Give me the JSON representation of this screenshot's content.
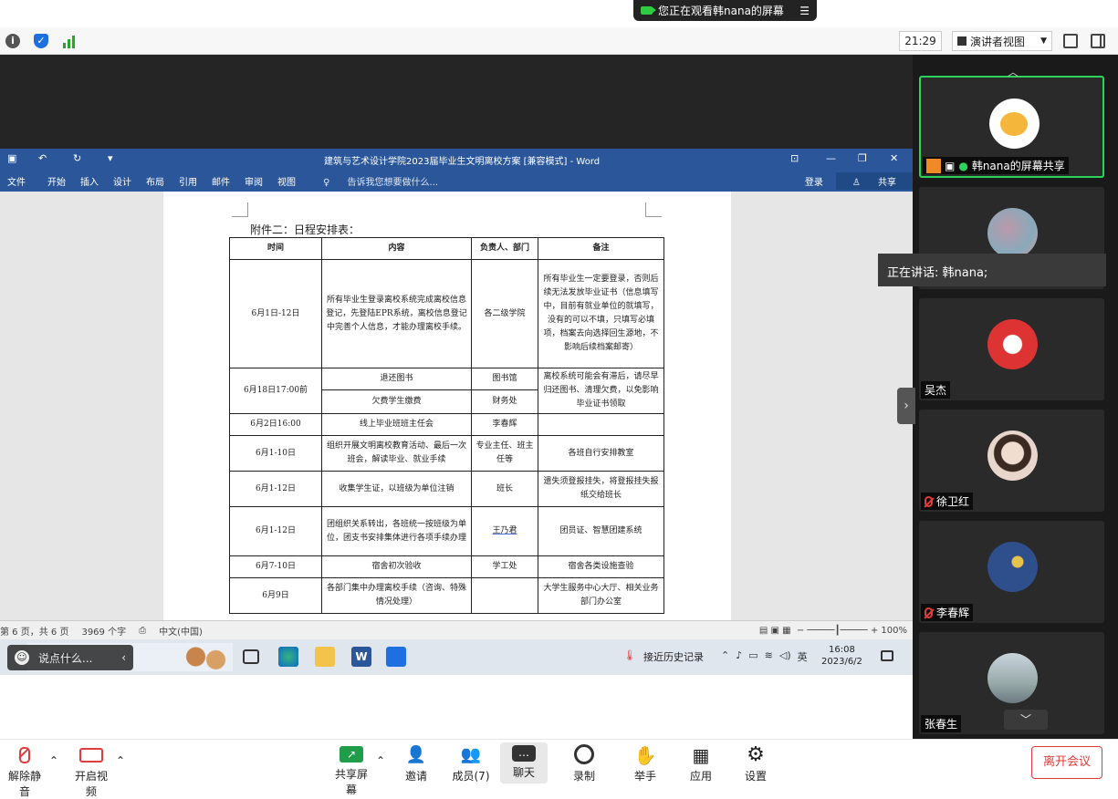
{
  "banner": {
    "text": "您正在观看韩nana的屏幕",
    "menu_icon": "menu-icon"
  },
  "topbar": {
    "time": "21:29",
    "view_label": "演讲者视图"
  },
  "word": {
    "title": "建筑与艺术设计学院2023届毕业生文明离校方案 [兼容模式] - Word",
    "menu": [
      "文件",
      "开始",
      "插入",
      "设计",
      "布局",
      "引用",
      "邮件",
      "审阅",
      "视图"
    ],
    "tell_me": "告诉我您想要做什么...",
    "login": "登录",
    "share": "共享",
    "status": {
      "pages": "第 6 页，共 6 页",
      "words": "3969 个字",
      "lang": "中文(中国)",
      "zoom": "100%"
    }
  },
  "doc": {
    "caption": "附件二：日程安排表：",
    "headers": [
      "时间",
      "内容",
      "负责人、部门",
      "备注"
    ],
    "rows": [
      {
        "time": "6月1日-12日",
        "content": "所有毕业生登录离校系统完成离校信息登记，先登陆EPR系统，离校信息登记中完善个人信息，才能办理离校手续。",
        "owner": "各二级学院",
        "note": "所有毕业生一定要登录，否则后续无法发放毕业证书（信息填写中，目前有就业单位的就填写，没有的可以不填，只填写必填项，档案去向选择回生源地，不影响后续档案邮寄）"
      },
      {
        "time": "6月18日17:00前",
        "content": "退还图书",
        "owner": "图书馆",
        "note": "离校系统可能会有滞后，请尽早归还图书、清理欠费，以免影响毕业证书领取"
      },
      {
        "time": "",
        "content": "欠费学生缴费",
        "owner": "财务处",
        "note": ""
      },
      {
        "time": "6月2日16:00",
        "content": "线上毕业班班主任会",
        "owner": "李春辉",
        "note": ""
      },
      {
        "time": "6月1-10日",
        "content": "组织开展文明离校教育活动、最后一次班会，解读毕业、就业手续",
        "owner": "专业主任、班主任等",
        "note": "各班自行安排教室"
      },
      {
        "time": "6月1-12日",
        "content": "收集学生证，以班级为单位注销",
        "owner": "班长",
        "note": "遗失须登报挂失，将登报挂失报纸交给班长"
      },
      {
        "time": "6月1-12日",
        "content": "团组织关系转出，各班统一按班级为单位，团支书安排集体进行各项手续办理",
        "owner": "王乃君",
        "note": "团员证、智慧团建系统"
      },
      {
        "time": "6月7-10日",
        "content": "宿舍初次验收",
        "owner": "学工处",
        "note": "宿舍各类设施查验"
      },
      {
        "time": "6月9日",
        "content": "各部门集中办理离校手续（咨询、特殊情况处理）",
        "owner": "",
        "note": "大学生服务中心大厅、相关业务部门办公室"
      }
    ]
  },
  "taskbar": {
    "search": "搜索",
    "history": "接近历史记录",
    "ime": "英",
    "time": "16:08",
    "date": "2023/6/2"
  },
  "chat_overlay": {
    "text": "说点什么..."
  },
  "participants": [
    {
      "name": "韩nana的屏幕共享",
      "avatar_color": "#f5b73b"
    },
    {
      "name": "",
      "avatar_color": "#8ab"
    },
    {
      "name": "吴杰",
      "avatar_color": "#d33"
    },
    {
      "name": "徐卫红",
      "avatar_color": "#e8d6cc"
    },
    {
      "name": "李春辉",
      "avatar_color": "#2f4e8c"
    },
    {
      "name": "张春生",
      "avatar_color": "#9aa"
    }
  ],
  "speaker": "正在讲话: 韩nana;",
  "bottom": {
    "unmute": "解除静音",
    "video": "开启视频",
    "share": "共享屏幕",
    "invite": "邀请",
    "members": "成员(7)",
    "chat": "聊天",
    "record": "录制",
    "raise": "举手",
    "apps": "应用",
    "settings": "设置",
    "leave": "离开会议"
  },
  "colors": {
    "word_blue": "#2b579a",
    "active_green": "#2bd35b",
    "leave_red": "#e23b3b"
  }
}
